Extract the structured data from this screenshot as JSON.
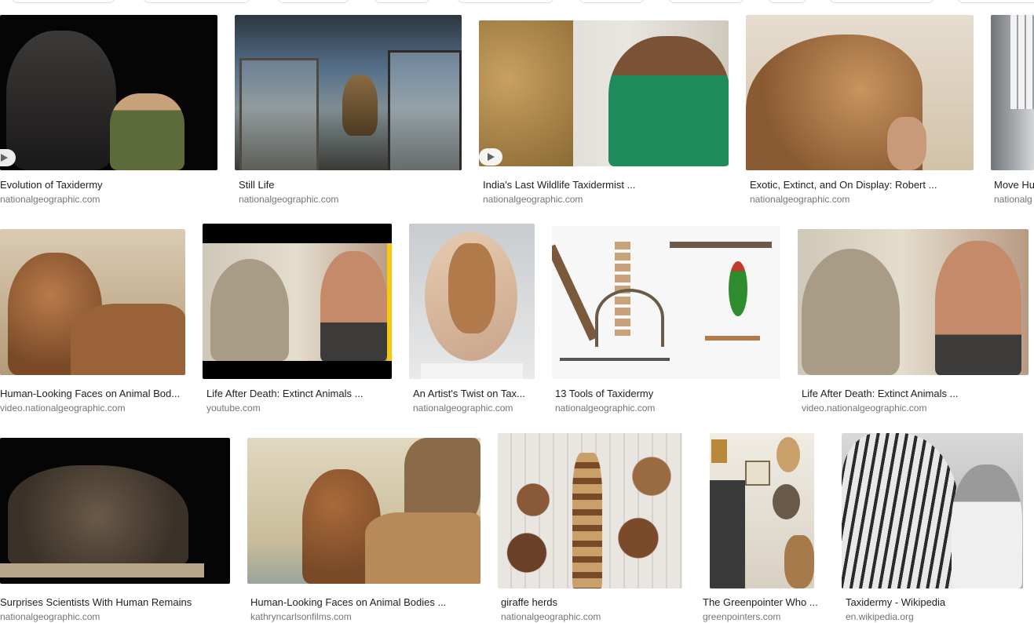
{
  "results": [
    {
      "title": "Evolution of Taxidermy",
      "source": "nationalgeographic.com"
    },
    {
      "title": "Still Life",
      "source": "nationalgeographic.com"
    },
    {
      "title": "India's Last Wildlife Taxidermist ...",
      "source": "nationalgeographic.com"
    },
    {
      "title": "Exotic, Extinct, and On Display: Robert ...",
      "source": "nationalgeographic.com"
    },
    {
      "title": "Move Hu",
      "source": "nationalg"
    },
    {
      "title": "Human-Looking Faces on Animal Bod...",
      "source": "video.nationalgeographic.com"
    },
    {
      "title": "Life After Death: Extinct Animals ...",
      "source": "youtube.com"
    },
    {
      "title": "An Artist's Twist on Tax...",
      "source": "nationalgeographic.com"
    },
    {
      "title": "13 Tools of Taxidermy",
      "source": "nationalgeographic.com"
    },
    {
      "title": "Life After Death: Extinct Animals ...",
      "source": "video.nationalgeographic.com"
    },
    {
      "title": "Surprises Scientists With Human Remains",
      "source": "nationalgeographic.com"
    },
    {
      "title": "Human-Looking Faces on Animal Bodies ...",
      "source": "kathryncarlsonfilms.com"
    },
    {
      "title": "giraffe herds",
      "source": "nationalgeographic.com"
    },
    {
      "title": "The Greenpointer Who ...",
      "source": "greenpointers.com"
    },
    {
      "title": "Taxidermy - Wikipedia",
      "source": "en.wikipedia.org"
    }
  ],
  "colors": {
    "caption": "#202124",
    "source": "#70757a",
    "chip_border": "#dadce0"
  },
  "icons": {
    "play": "play-icon"
  }
}
